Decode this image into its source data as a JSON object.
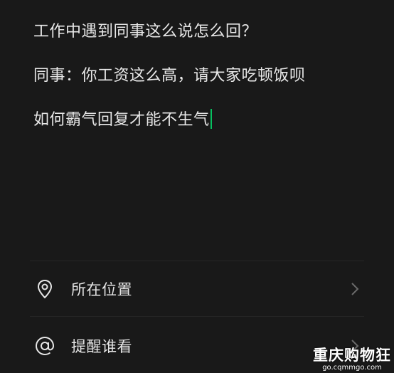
{
  "editor": {
    "lines": [
      "工作中遇到同事这么说怎么回？",
      "同事：你工资这么高，请大家吃顿饭呗",
      "如何霸气回复才能不生气"
    ],
    "cursor_color": "#07c160"
  },
  "options": [
    {
      "label": "所在位置",
      "icon": "location-pin-icon"
    },
    {
      "label": "提醒谁看",
      "icon": "at-sign-icon"
    }
  ],
  "watermark": {
    "title": "重庆购物狂",
    "url": "go.cqmmgo.com"
  }
}
